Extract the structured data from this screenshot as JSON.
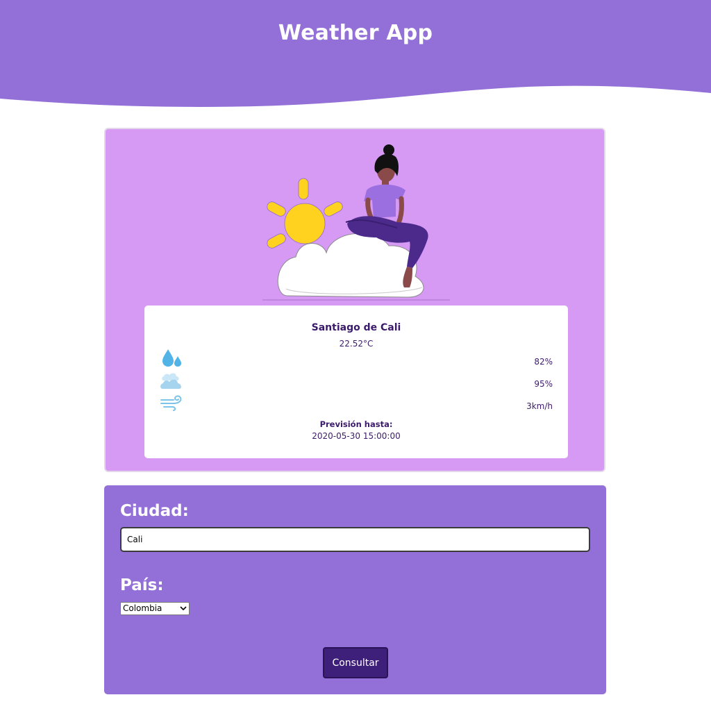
{
  "header": {
    "title": "Weather App"
  },
  "weather": {
    "city": "Santiago de Cali",
    "temperature": "22.52°C",
    "humidity": {
      "icon": "humidity-drops-icon",
      "value": "82%"
    },
    "clouds": {
      "icon": "clouds-icon",
      "value": "95%"
    },
    "wind": {
      "icon": "wind-icon",
      "value": "3km/h"
    },
    "forecast_label": "Previsión hasta:",
    "forecast_date": "2020-05-30 15:00:00"
  },
  "form": {
    "city_label": "Ciudad:",
    "city_value": "Cali",
    "country_label": "País:",
    "country_selected": "Colombia",
    "submit_label": "Consultar"
  },
  "colors": {
    "header_purple": "#9370d8",
    "card_lilac": "#d69af5",
    "text_dark_purple": "#3b1a6b",
    "button_purple": "#3e1f79"
  }
}
